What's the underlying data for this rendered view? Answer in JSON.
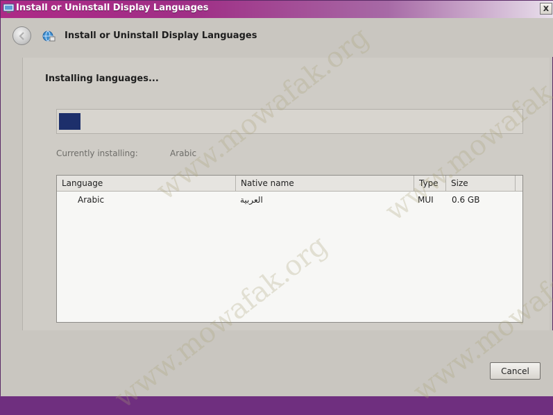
{
  "window": {
    "title": "Install or Uninstall Display Languages",
    "close_label": "x"
  },
  "nav": {
    "title": "Install or Uninstall Display Languages"
  },
  "content": {
    "heading": "Installing languages...",
    "progress_fraction": 0.046,
    "status_label": "Currently installing:",
    "status_value": "Arabic"
  },
  "table": {
    "columns": [
      "Language",
      "Native name",
      "Type",
      "Size"
    ],
    "rows": [
      {
        "language": "Arabic",
        "native_name": "العربية",
        "type": "MUI",
        "size": "0.6 GB"
      }
    ]
  },
  "footer": {
    "cancel_label": "Cancel"
  },
  "watermark_text": "www.mowafak.org",
  "colors": {
    "title_gradient_start": "#ad2a86",
    "progress_fill": "#1d2f6b",
    "window_bg": "#c9c6c0"
  },
  "icons": [
    "window-app-icon",
    "back-arrow-icon",
    "display-languages-icon"
  ]
}
